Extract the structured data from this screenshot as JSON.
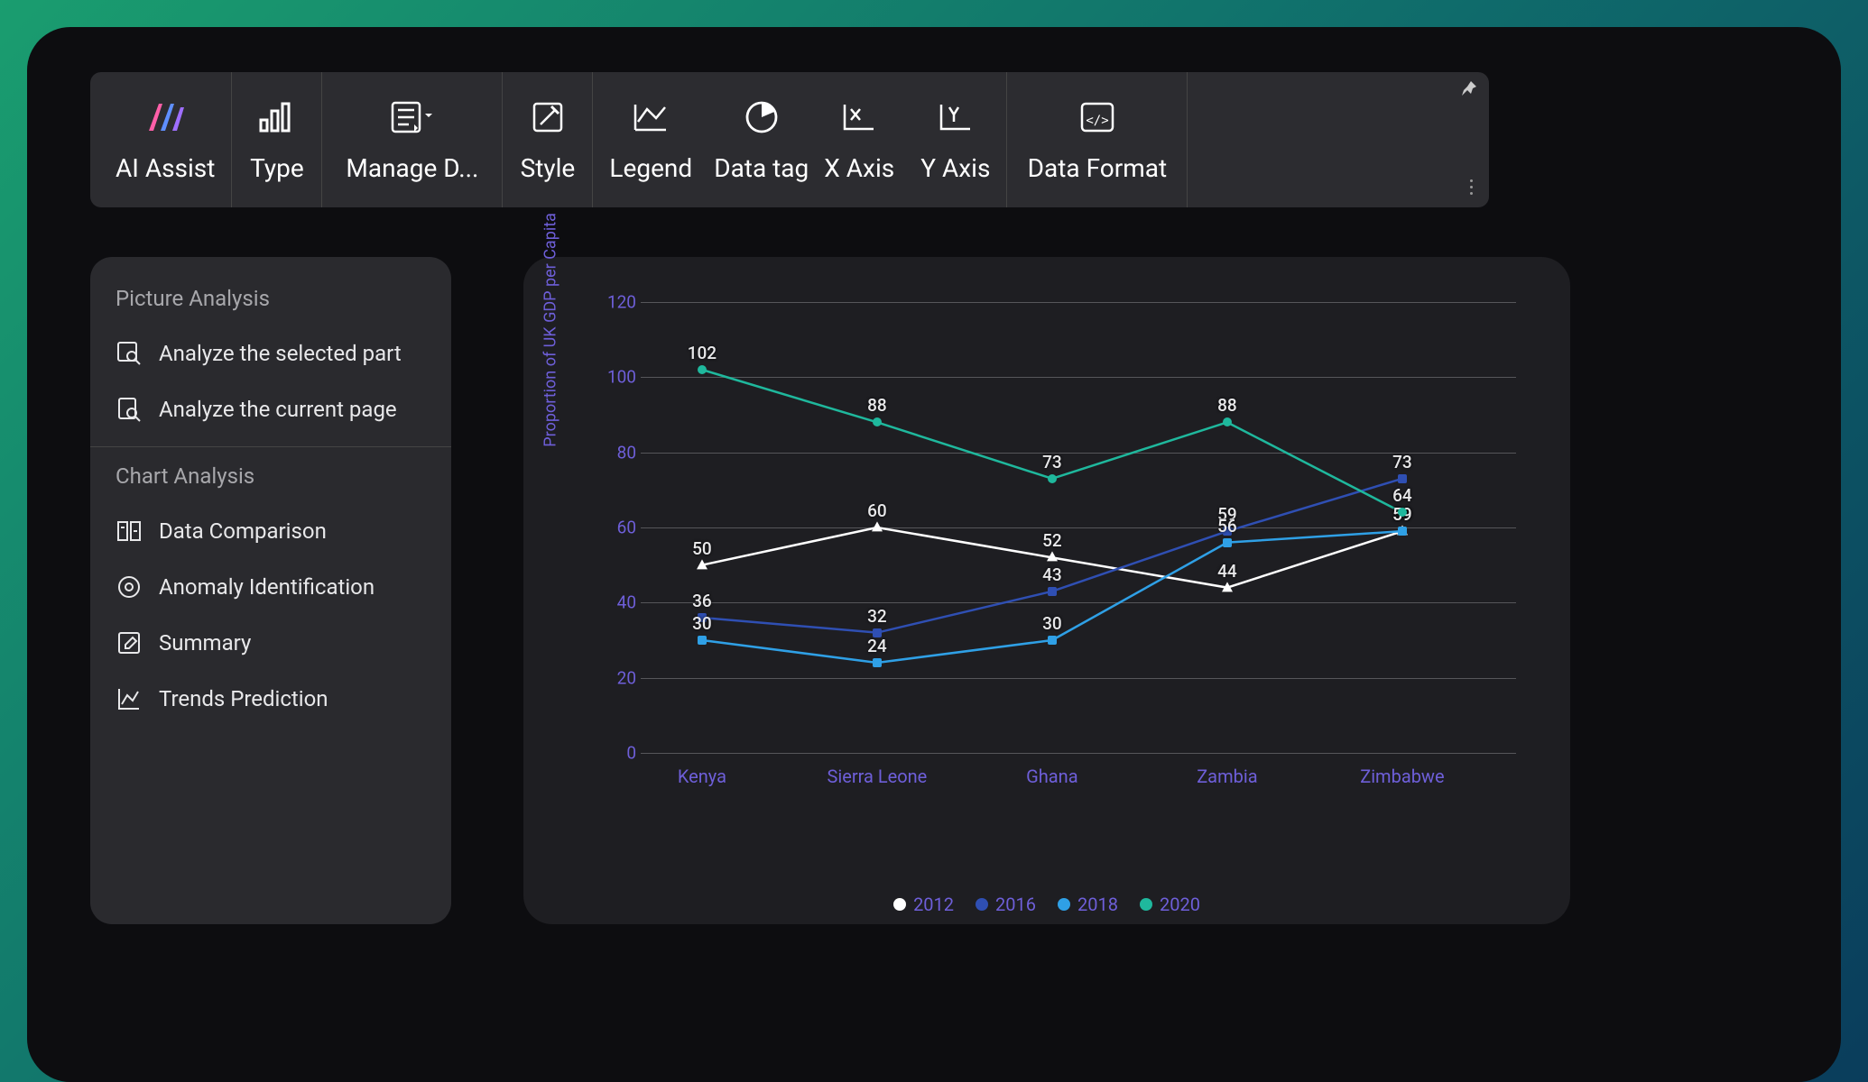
{
  "toolbar": {
    "items": [
      {
        "label": "AI Assist"
      },
      {
        "label": "Type"
      },
      {
        "label": "Manage D..."
      },
      {
        "label": "Style"
      },
      {
        "label": "Legend"
      },
      {
        "label": "Data tag"
      },
      {
        "label": "X Axis"
      },
      {
        "label": "Y Axis"
      },
      {
        "label": "Data Format"
      }
    ]
  },
  "side_panel": {
    "section1_title": "Picture Analysis",
    "section1_items": [
      "Analyze the selected part",
      "Analyze the current page"
    ],
    "section2_title": "Chart Analysis",
    "section2_items": [
      "Data Comparison",
      "Anomaly Identification",
      "Summary",
      "Trends Prediction"
    ]
  },
  "chart_data": {
    "type": "line",
    "ylabel": "Proportion of UK GDP per Capita",
    "xlabel": "",
    "ylim": [
      0,
      120
    ],
    "yticks": [
      0,
      20,
      40,
      60,
      80,
      100,
      120
    ],
    "categories": [
      "Kenya",
      "Sierra Leone",
      "Ghana",
      "Zambia",
      "Zimbabwe"
    ],
    "series": [
      {
        "name": "2012",
        "color": "#ffffff",
        "marker": "tri",
        "values": [
          50,
          60,
          52,
          44,
          59
        ]
      },
      {
        "name": "2016",
        "color": "#2f4fb3",
        "marker": "sq",
        "values": [
          36,
          32,
          43,
          59,
          73
        ]
      },
      {
        "name": "2018",
        "color": "#2fa0e6",
        "marker": "sq",
        "values": [
          30,
          24,
          30,
          56,
          59
        ]
      },
      {
        "name": "2020",
        "color": "#1fb89d",
        "marker": "dot",
        "values": [
          102,
          88,
          73,
          88,
          64
        ]
      }
    ],
    "legend": [
      "2012",
      "2016",
      "2018",
      "2020"
    ],
    "legend_colors": [
      "#ffffff",
      "#2f4fb3",
      "#2fa0e6",
      "#1fb89d"
    ]
  }
}
